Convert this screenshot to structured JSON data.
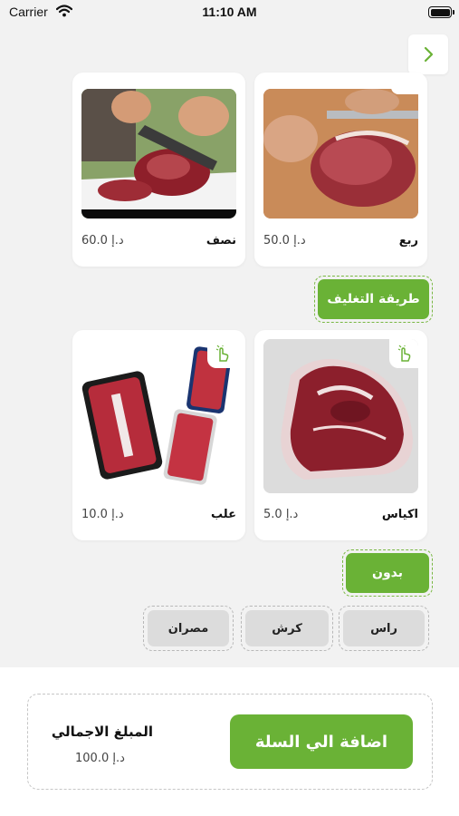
{
  "status_bar": {
    "carrier": "Carrier",
    "time": "11:10 AM"
  },
  "colors": {
    "accent": "#6ab236",
    "chip_bg": "#dcdcdc",
    "background": "#f2f2f2"
  },
  "cut_options": [
    {
      "name": "نصف",
      "price": "60.0 د.إ"
    },
    {
      "name": "ربع",
      "price": "50.0 د.إ"
    }
  ],
  "packaging": {
    "title": "طريقة التغليف",
    "options": [
      {
        "name": "علب",
        "price": "10.0 د.إ"
      },
      {
        "name": "اكياس",
        "price": "5.0 د.إ"
      }
    ]
  },
  "extras": {
    "title": "بدون",
    "options": [
      "مصران",
      "كرش",
      "راس"
    ]
  },
  "footer": {
    "total_label": "المبلغ الاجمالي",
    "total_value": "100.0 د.إ",
    "add_to_cart": "اضافة الي السلة"
  },
  "icons": {
    "back": "chevron-right-icon",
    "select": "hand-pointer-icon",
    "wifi": "wifi-icon",
    "battery": "battery-icon"
  }
}
